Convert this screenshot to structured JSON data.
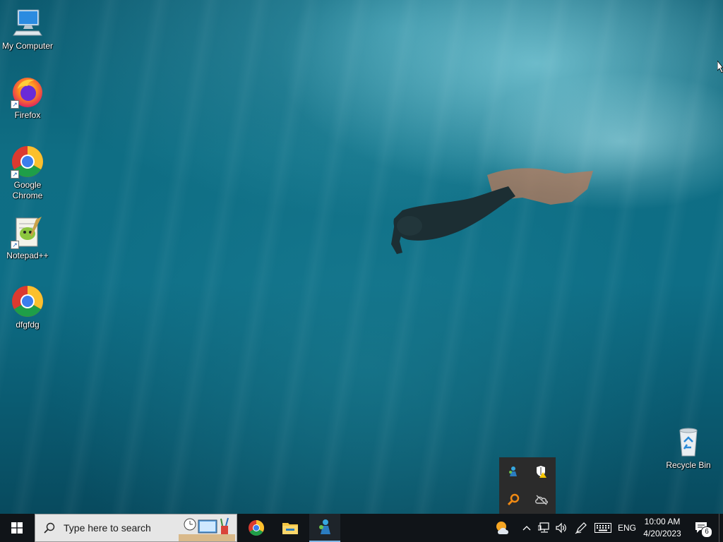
{
  "desktop": {
    "icons": [
      {
        "label": "My Computer",
        "icon": "computer-icon"
      },
      {
        "label": "Firefox",
        "icon": "firefox-icon"
      },
      {
        "label": "Google Chrome",
        "icon": "chrome-icon"
      },
      {
        "label": "Notepad++",
        "icon": "notepadpp-icon"
      },
      {
        "label": "dfgfdg",
        "icon": "chrome-icon"
      },
      {
        "label": "Recycle Bin",
        "icon": "recycle-bin-icon"
      }
    ]
  },
  "taskbar": {
    "search_placeholder": "Type here to search",
    "pinned": [
      "chrome-icon",
      "file-explorer-icon",
      "app-icon"
    ],
    "language": "ENG",
    "time": "10:00 AM",
    "date": "4/20/2023",
    "notification_count": "6"
  },
  "tray_popup": {
    "icons": [
      "network-app-icon",
      "security-warning-icon",
      "search-tool-icon",
      "onedrive-off-icon"
    ]
  },
  "colors": {
    "taskbar_bg": "#101418",
    "search_bg": "#e6e6e6",
    "popup_bg": "#2b2b2b"
  }
}
